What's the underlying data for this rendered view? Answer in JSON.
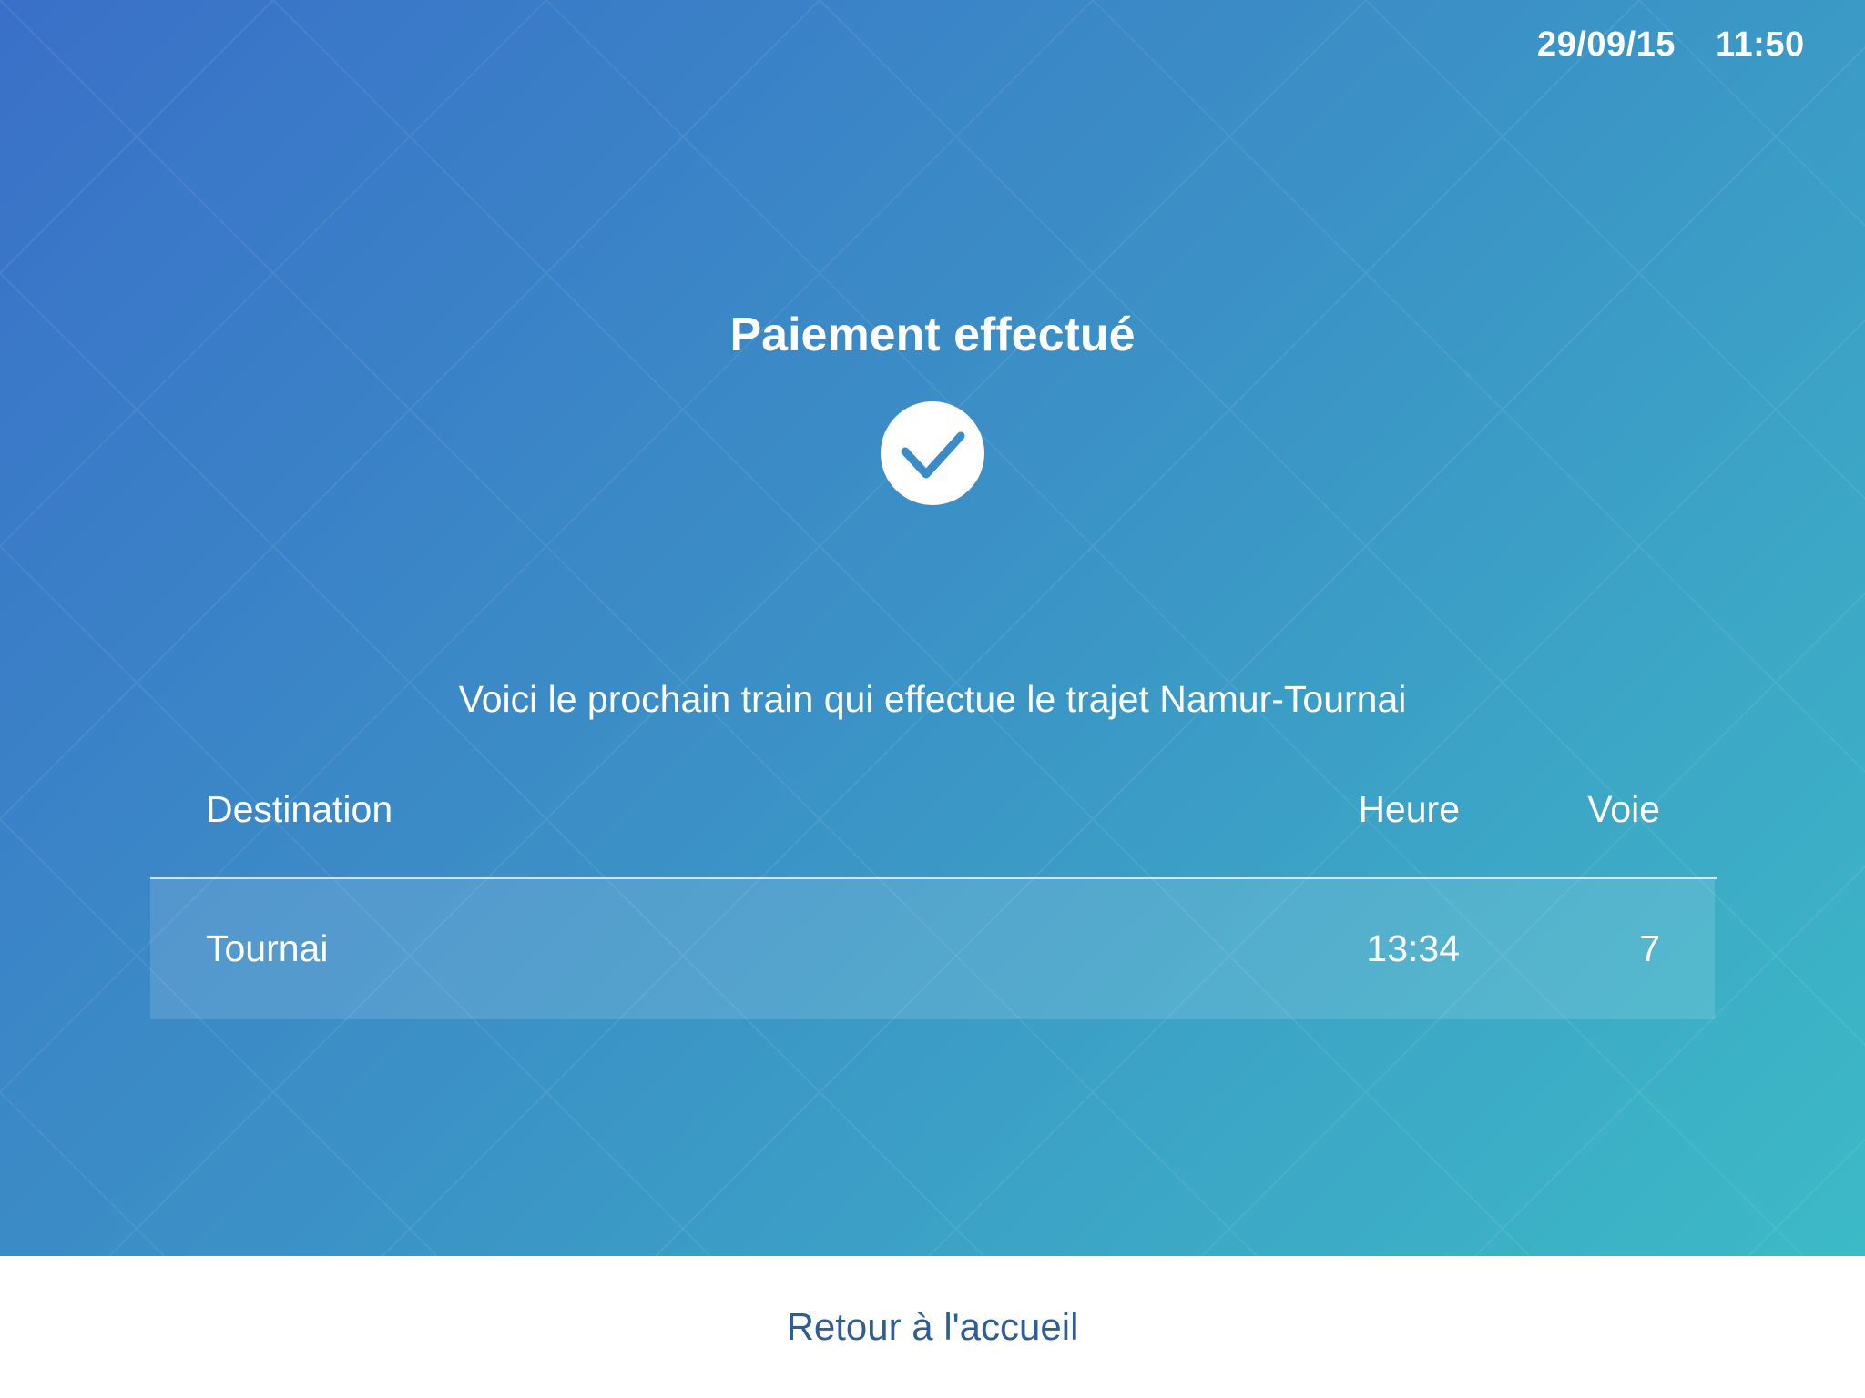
{
  "status": {
    "date": "29/09/15",
    "time": "11:50"
  },
  "confirmation": {
    "title": "Paiement effectué",
    "icon": "check-circle-icon",
    "subtitle": "Voici le prochain train qui effectue le trajet Namur-Tournai"
  },
  "table": {
    "headers": {
      "destination": "Destination",
      "time": "Heure",
      "track": "Voie"
    },
    "rows": [
      {
        "destination": "Tournai",
        "time": "13:34",
        "track": "7"
      }
    ]
  },
  "footer": {
    "home_label": "Retour à l'accueil"
  },
  "colors": {
    "gradient_start": "#3a70c8",
    "gradient_end": "#3cbac6",
    "footer_text": "#2f5e96",
    "check_color": "#3b8cc6"
  }
}
